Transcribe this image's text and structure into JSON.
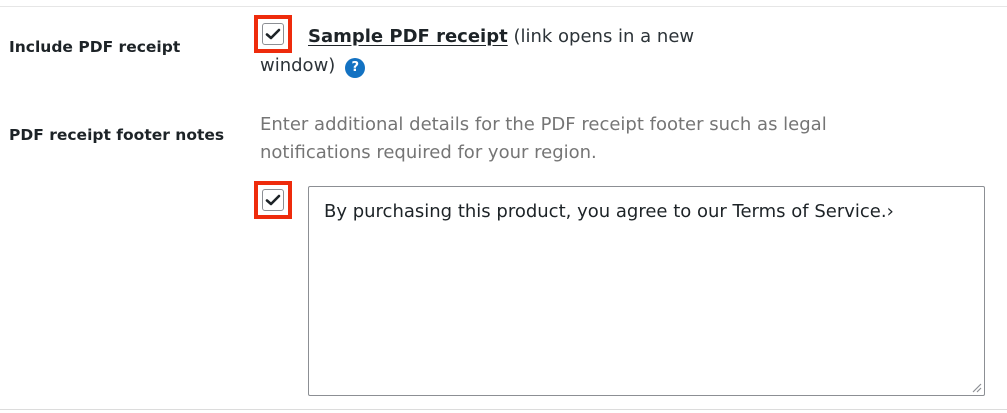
{
  "include_pdf_receipt": {
    "label": "Include PDF receipt",
    "checked": true,
    "link_text": "Sample PDF receipt",
    "link_note": "(link opens in a new window)",
    "help_icon": "?"
  },
  "footer_notes": {
    "label": "PDF receipt footer notes",
    "description": "Enter additional details for the PDF receipt footer such as legal notifications required for your region.",
    "checked": true,
    "textarea_value": "By purchasing this product, you agree to our Terms of Service.›"
  },
  "icons": {
    "checkbox": "check-icon",
    "help": "question-circle-icon",
    "resize": "resize-grip-icon"
  },
  "colors": {
    "highlight": "#ee2b0c",
    "help_icon": "#1372c2",
    "description_text": "#757575"
  }
}
